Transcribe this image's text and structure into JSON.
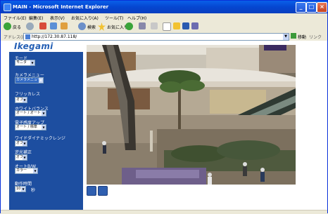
{
  "window": {
    "title": "MAIN - Microsoft Internet Explorer"
  },
  "menu": [
    "ファイル(E)",
    "編集(E)",
    "表示(V)",
    "お気に入り(A)",
    "ツール(T)",
    "ヘルプ(H)"
  ],
  "toolbar": {
    "back": "戻る",
    "search": "検索",
    "favorites": "お気に入り"
  },
  "address": {
    "label": "アドレス(D)",
    "url": "http://172.30.87.118/",
    "go": "移動",
    "links": "リンク"
  },
  "brand": {
    "logo": "Ikegami"
  },
  "settings": {
    "mode": {
      "label": "モード",
      "value": "モニタ"
    },
    "camera_menu": {
      "label": "カメラメニュー",
      "value": "カメラメニュー"
    },
    "flickerless": {
      "label": "フリッカレス",
      "value": "オフ"
    },
    "white_balance": {
      "label": "ホワイトバランス",
      "value": "オート / オート"
    },
    "shutter": {
      "label": "電子感度アップ",
      "value": "オート / 標準"
    },
    "wdr": {
      "label": "ワイドダイナミックレンジ",
      "value": "オフ"
    },
    "backlight": {
      "label": "逆光補正",
      "value": "オフ"
    },
    "day_night": {
      "label": "オートB/W",
      "value": "カラー"
    },
    "interval": {
      "label": "動作時間",
      "value": "10",
      "unit": "秒"
    }
  },
  "colors": {
    "sidebar": "#1d4ea0",
    "titlebar": "#0546d0"
  }
}
